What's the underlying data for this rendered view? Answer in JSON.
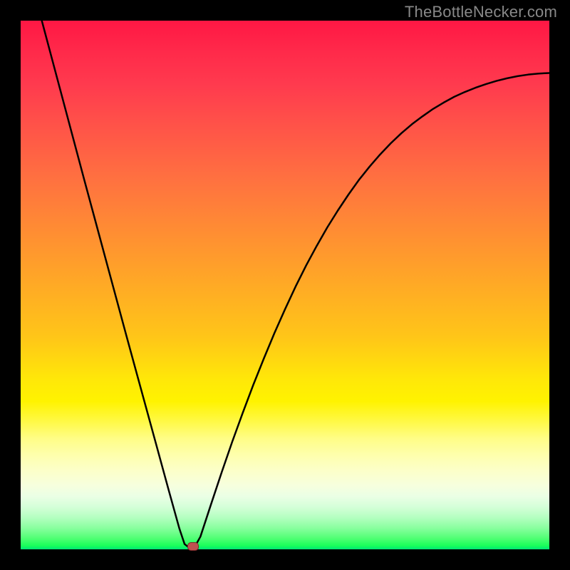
{
  "watermark": "TheBottleNecker.com",
  "chart_data": {
    "type": "line",
    "title": "",
    "xlabel": "",
    "ylabel": "",
    "xlim": [
      0,
      100
    ],
    "ylim": [
      0,
      100
    ],
    "curve": {
      "x": [
        4,
        6,
        8,
        10,
        12,
        14,
        16,
        18,
        20,
        22,
        24,
        26,
        28,
        30,
        31,
        31.5,
        32,
        33,
        34,
        36,
        38,
        40,
        42,
        44,
        46,
        48,
        50,
        52,
        54,
        56,
        58,
        60,
        62,
        64,
        66,
        68,
        70,
        72,
        74,
        76,
        78,
        80,
        82,
        84,
        86,
        88,
        90,
        92,
        94,
        96,
        98,
        100
      ],
      "y": [
        100,
        92.5,
        85,
        77.5,
        70,
        62.6,
        55.2,
        47.8,
        40.4,
        33.1,
        25.8,
        18.5,
        11.2,
        4,
        1,
        0.6,
        0.6,
        0.6,
        2.4,
        8.5,
        14.5,
        20.3,
        25.8,
        31.1,
        36.1,
        40.9,
        45.4,
        49.7,
        53.7,
        57.4,
        60.9,
        64.1,
        67.1,
        69.9,
        72.4,
        74.7,
        76.8,
        78.7,
        80.4,
        81.9,
        83.3,
        84.5,
        85.6,
        86.5,
        87.3,
        88.0,
        88.6,
        89.1,
        89.5,
        89.8,
        90.0,
        90.1
      ]
    },
    "marker": {
      "x": 32.5,
      "y": 0.7
    },
    "gradient_description": "red(top)→orange→yellow→green(bottom)"
  }
}
